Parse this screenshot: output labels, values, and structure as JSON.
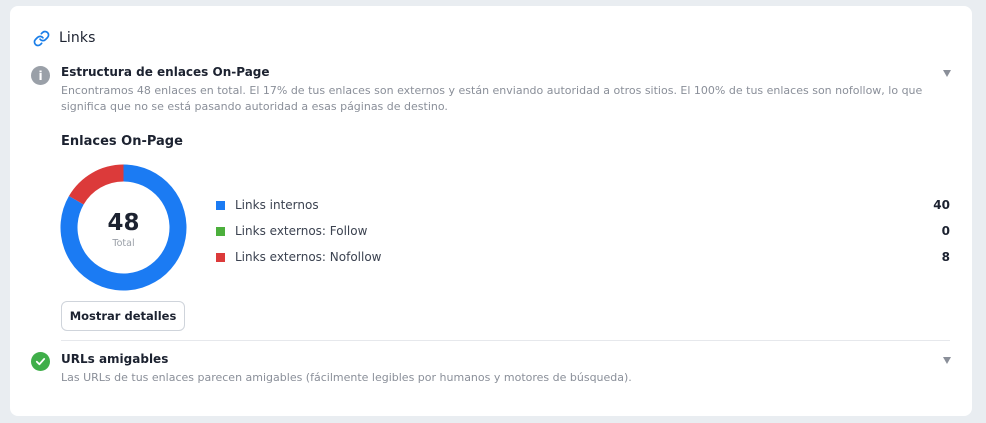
{
  "card": {
    "title": "Links",
    "icon": "link-icon"
  },
  "colors": {
    "accent": "#1a7ee8",
    "internal": "#1b7bf3",
    "follow": "#4caf3c",
    "nofollow": "#dc3a3a",
    "info": "#9aa0a8",
    "success": "#3fae49"
  },
  "structure": {
    "status_icon": "info-icon",
    "title": "Estructura de enlaces On-Page",
    "description": "Encontramos 48 enlaces en total. El 17% de tus enlaces son externos y están enviando autoridad a otros sitios. El 100% de tus enlaces son nofollow, lo que significa que no se está pasando autoridad a esas páginas de destino."
  },
  "chart_section": {
    "heading": "Enlaces On-Page",
    "button_label": "Mostrar detalles"
  },
  "chart_data": {
    "type": "pie",
    "center_value": "48",
    "center_label": "Total",
    "series": [
      {
        "name": "Links internos",
        "value": 40,
        "color": "#1b7bf3"
      },
      {
        "name": "Links externos: Follow",
        "value": 0,
        "color": "#4caf3c"
      },
      {
        "name": "Links externos: Nofollow",
        "value": 8,
        "color": "#dc3a3a"
      }
    ]
  },
  "friendly_urls": {
    "status_icon": "check-icon",
    "title": "URLs amigables",
    "description": "Las URLs de tus enlaces parecen amigables (fácilmente legibles por humanos y motores de búsqueda)."
  }
}
